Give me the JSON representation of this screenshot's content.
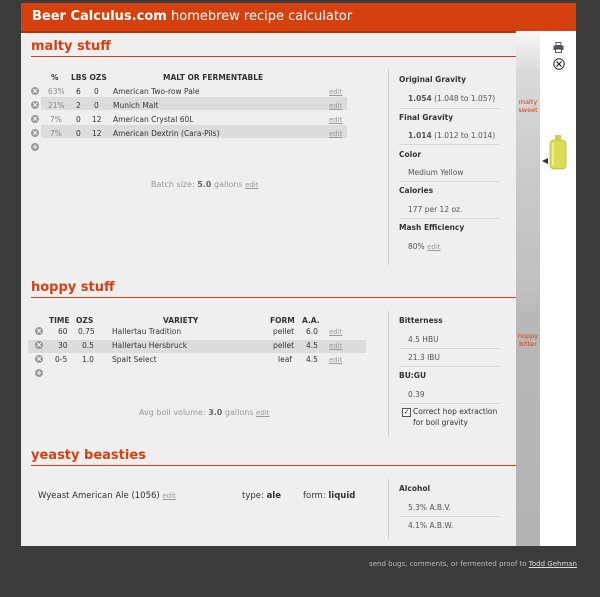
{
  "header": {
    "brand": "Beer Calculus.com",
    "tagline": "homebrew recipe calculator"
  },
  "malt": {
    "title": "malty stuff",
    "columns": {
      "pct": "%",
      "lbs_ozs": "LBS OZS",
      "name": "MALT OR FERMENTABLE"
    },
    "rows": [
      {
        "pct": "63%",
        "lbs": "6",
        "ozs": "0",
        "name": "American Two-row Pale",
        "edit": "edit"
      },
      {
        "pct": "21%",
        "lbs": "2",
        "ozs": "0",
        "name": "Munich Malt",
        "edit": "edit"
      },
      {
        "pct": "7%",
        "lbs": "0",
        "ozs": "12",
        "name": "American Crystal 60L",
        "edit": "edit"
      },
      {
        "pct": "7%",
        "lbs": "0",
        "ozs": "12",
        "name": "American Dextrin (Cara-Pils)",
        "edit": "edit"
      }
    ],
    "batch_label": "Batch size:",
    "batch_value": "5.0",
    "batch_unit": "gallons",
    "batch_edit": "edit"
  },
  "malt_panel": {
    "og_label": "Original Gravity",
    "og_value": "1.054",
    "og_range": "(1.048 to 1.057)",
    "fg_label": "Final Gravity",
    "fg_value": "1.014",
    "fg_range": "(1.012 to 1.014)",
    "color_label": "Color",
    "color_value": "Medium Yellow",
    "cal_label": "Calories",
    "cal_value": "177 per 12 oz.",
    "mash_label": "Mash Efficiency",
    "mash_value": "80%",
    "mash_edit": "edit"
  },
  "hops": {
    "title": "hoppy stuff",
    "columns": {
      "time": "TIME",
      "ozs": "OZS",
      "variety": "VARIETY",
      "form": "FORM",
      "aa": "A.A."
    },
    "rows": [
      {
        "time": "60",
        "ozs": "0.75",
        "variety": "Hallertau Tradition",
        "form": "pellet",
        "aa": "6.0",
        "edit": "edit"
      },
      {
        "time": "30",
        "ozs": "0.5",
        "variety": "Hallertau Hersbruck",
        "form": "pellet",
        "aa": "4.5",
        "edit": "edit"
      },
      {
        "time": "0-5",
        "ozs": "1.0",
        "variety": "Spalt Select",
        "form": "leaf",
        "aa": "4.5",
        "edit": "edit"
      }
    ],
    "boil_label": "Avg boil volume:",
    "boil_value": "3.0",
    "boil_unit": "gallons",
    "boil_edit": "edit"
  },
  "hops_panel": {
    "bitterness_label": "Bitterness",
    "hbu": "4.5 HBU",
    "ibu": "21.3 IBU",
    "bugu_label": "BU:GU",
    "bugu_value": "0.39",
    "correct_label_1": "Correct hop extraction",
    "correct_label_2": "for boil gravity",
    "correct_checked": true
  },
  "yeast": {
    "title": "yeasty beasties",
    "name": "Wyeast American Ale (1056)",
    "edit": "edit",
    "type_label": "type:",
    "type_value": "ale",
    "form_label": "form:",
    "form_value": "liquid"
  },
  "yeast_panel": {
    "alcohol_label": "Alcohol",
    "abv": "5.3% A.B.V.",
    "abw": "4.1% A.B.W."
  },
  "scale": {
    "malty_line1": "malty",
    "malty_line2": "sweet",
    "hoppy_line1": "hoppy",
    "hoppy_line2": "bitter"
  },
  "sidebar": {
    "print_icon": "print-icon",
    "close_icon": "close-icon",
    "glass_icon": "beer-glass-icon",
    "glass_color": "#d9dc55"
  },
  "colors": {
    "accent": "#d6400e",
    "page_bg": "#3b3b3b",
    "app_bg": "#efefef"
  },
  "footer": {
    "text": "send bugs, comments, or fermented proof to",
    "link": "Todd Gehman"
  }
}
